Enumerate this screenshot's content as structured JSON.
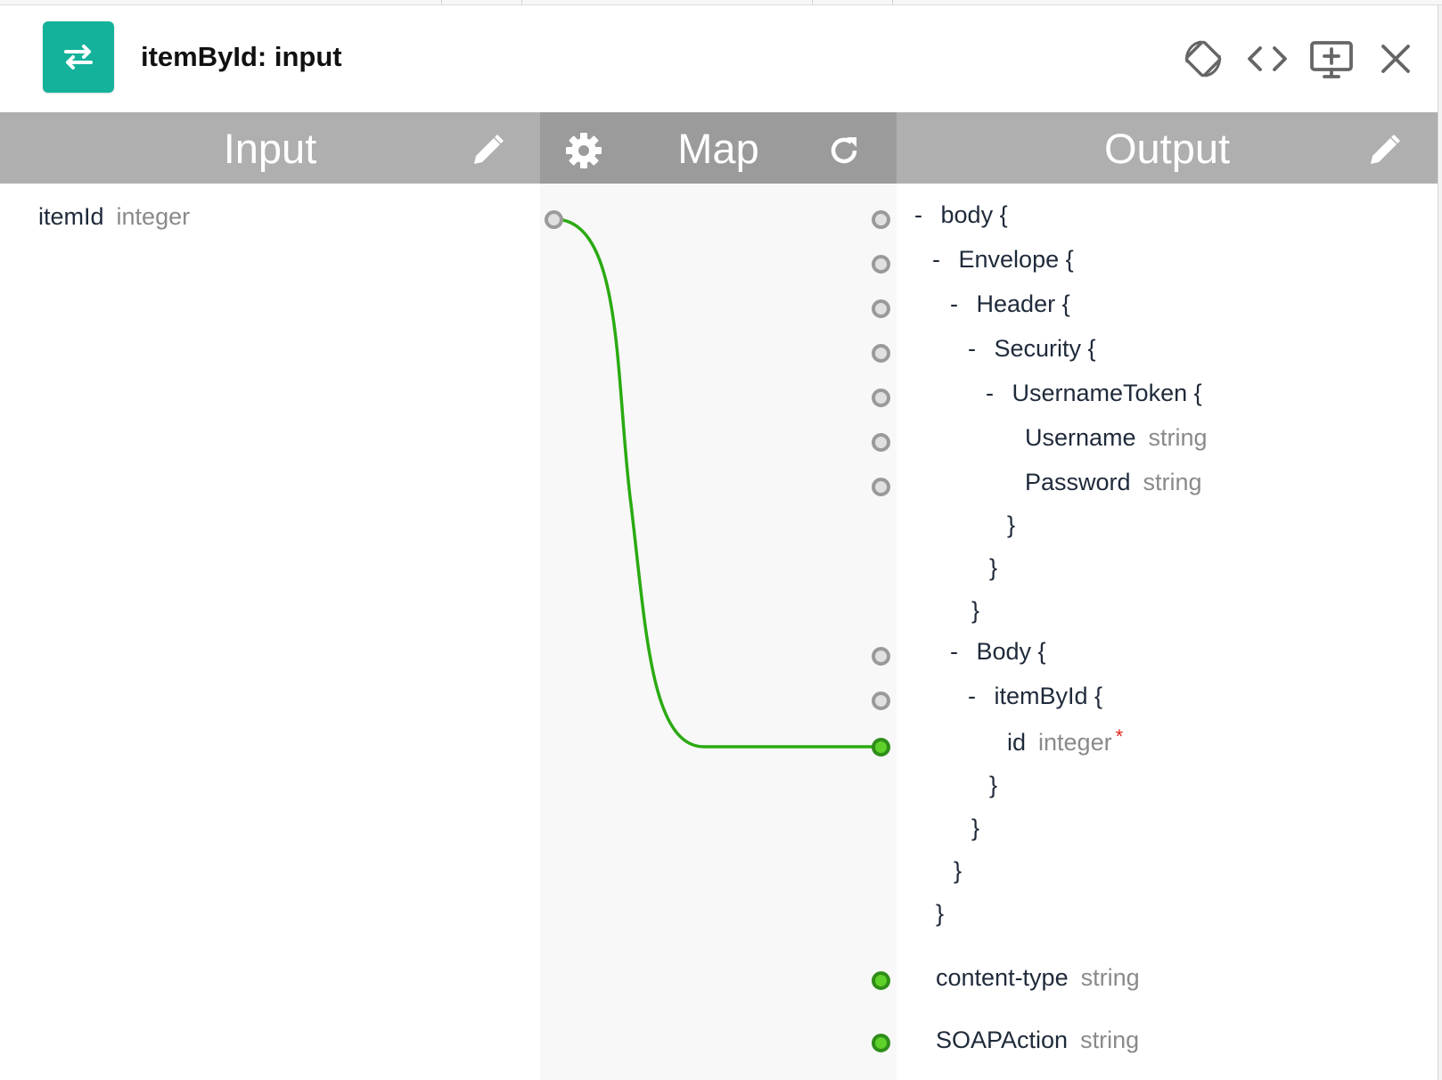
{
  "header": {
    "title": "itemById: input",
    "app_icon": "swap-arrows-icon",
    "actions": [
      {
        "name": "rotate-layout-icon"
      },
      {
        "name": "code-view-icon"
      },
      {
        "name": "add-screen-icon"
      },
      {
        "name": "close-icon"
      }
    ]
  },
  "columns": {
    "input": {
      "label": "Input",
      "edit_icon": "pencil-icon"
    },
    "map": {
      "label": "Map",
      "settings_icon": "gear-icon",
      "refresh_icon": "refresh-icon"
    },
    "output": {
      "label": "Output",
      "edit_icon": "pencil-icon"
    }
  },
  "input_fields": [
    {
      "name": "itemId",
      "type": "integer"
    }
  ],
  "output_tree": {
    "lines": {
      "l0": {
        "prefix": "-",
        "text": "body {"
      },
      "l1": {
        "prefix": "-",
        "text": "Envelope {"
      },
      "l2": {
        "prefix": "-",
        "text": "Header {"
      },
      "l3": {
        "prefix": "-",
        "text": "Security {"
      },
      "l4": {
        "prefix": "-",
        "text": "UsernameToken {"
      },
      "l5": {
        "name": "Username",
        "type": "string"
      },
      "l6": {
        "name": "Password",
        "type": "string"
      },
      "l7": {
        "text": "}"
      },
      "l8": {
        "text": "}"
      },
      "l9": {
        "text": "}"
      },
      "l10": {
        "prefix": "-",
        "text": "Body {"
      },
      "l11": {
        "prefix": "-",
        "text": "itemById {"
      },
      "l12": {
        "name": "id",
        "type": "integer",
        "required": "*"
      },
      "l13": {
        "text": "}"
      },
      "l14": {
        "text": "}"
      },
      "l15": {
        "text": "}"
      },
      "l16": {
        "text": "}"
      }
    },
    "headers": [
      {
        "name": "content-type",
        "type": "string"
      },
      {
        "name": "SOAPAction",
        "type": "string"
      }
    ]
  },
  "colors": {
    "accent": "#14b29a",
    "connection": "#2aaa12",
    "connected_dot": "#5fd12b",
    "required_mark": "#e0261d"
  }
}
